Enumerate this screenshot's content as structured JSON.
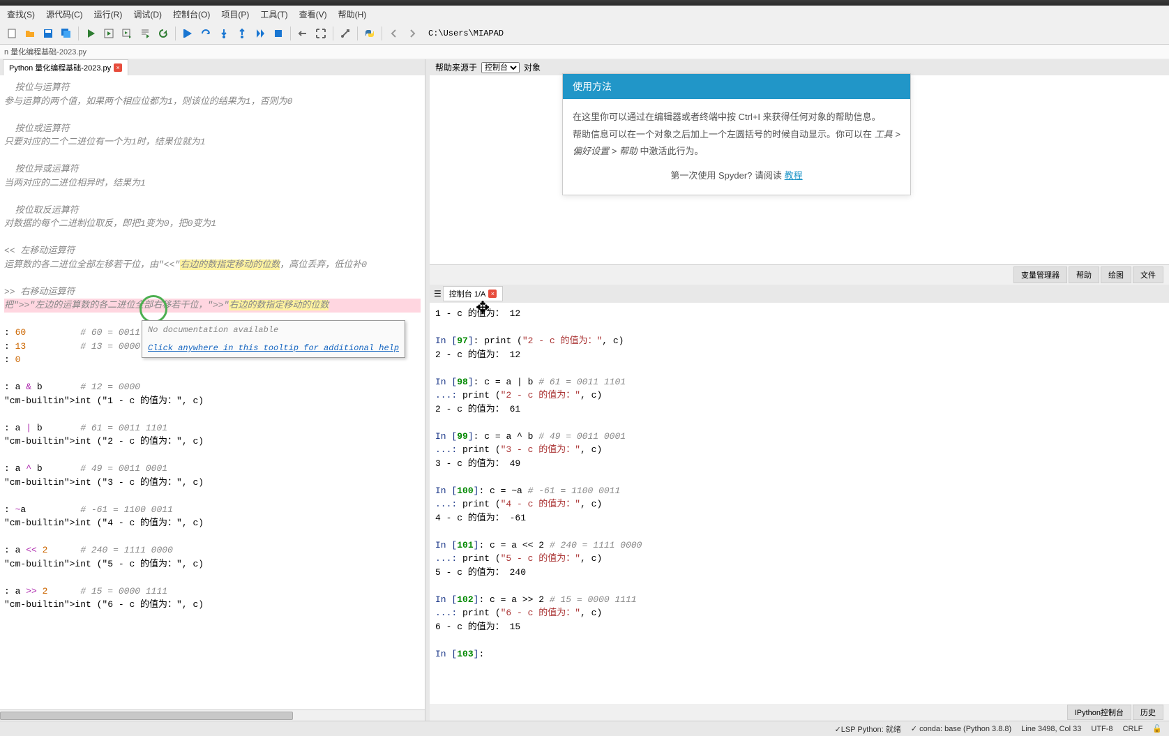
{
  "menubar": [
    "查找(S)",
    "源代码(C)",
    "运行(R)",
    "调试(D)",
    "控制台(O)",
    "项目(P)",
    "工具(T)",
    "查看(V)",
    "帮助(H)"
  ],
  "path": "C:\\Users\\MIAPAD",
  "breadcrumb": "n 量化编程基础-2023.py",
  "tab_name": "Python 量化编程基础-2023.py",
  "code_lines": [
    {
      "t": "comment",
      "x": "  按位与运算符"
    },
    {
      "t": "comment",
      "x": "参与运算的两个值，如果两个相应位都为1，则该位的结果为1，否则为0"
    },
    {
      "t": "blank",
      "x": ""
    },
    {
      "t": "comment",
      "x": "  按位或运算符"
    },
    {
      "t": "comment",
      "x": "只要对应的二个二进位有一个为1时，结果位就为1"
    },
    {
      "t": "blank",
      "x": ""
    },
    {
      "t": "comment",
      "x": "  按位异或运算符"
    },
    {
      "t": "comment",
      "x": "当两对应的二进位相异时，结果为1"
    },
    {
      "t": "blank",
      "x": ""
    },
    {
      "t": "comment",
      "x": "  按位取反运算符"
    },
    {
      "t": "comment",
      "x": "对数据的每个二进制位取反，即把1变为0，把0变为1"
    },
    {
      "t": "blank",
      "x": ""
    },
    {
      "t": "hl1a",
      "x": "<< 左移动运算符"
    },
    {
      "t": "hl1b",
      "x": "运算数的各二进位全部左移若干位，由\"<<\"",
      "hl": "右边的数指定移动的位数",
      "after": "，高位丢弃，低位补0"
    },
    {
      "t": "blank",
      "x": ""
    },
    {
      "t": "hl2a",
      "x": ">> 右移动运算符"
    },
    {
      "t": "hl2b",
      "x": "把\">>\"左边的运算数的各二进位全部右移若干位，\">>\"",
      "hl": "右边的数指定移动的位数"
    },
    {
      "t": "blank",
      "x": ""
    },
    {
      "t": "code",
      "x": ": 60          # 60 = 0011 1100"
    },
    {
      "t": "code",
      "x": ": 13          # 13 = 0000 1101"
    },
    {
      "t": "code",
      "x": ": 0"
    },
    {
      "t": "blank",
      "x": ""
    },
    {
      "t": "code",
      "x": ": a & b       # 12 = 0000"
    },
    {
      "t": "print",
      "x": "int (\"1 - c 的值为：\", c)"
    },
    {
      "t": "blank",
      "x": ""
    },
    {
      "t": "code",
      "x": ": a | b       # 61 = 0011 1101"
    },
    {
      "t": "print",
      "x": "int (\"2 - c 的值为：\", c)"
    },
    {
      "t": "blank",
      "x": ""
    },
    {
      "t": "code",
      "x": ": a ^ b       # 49 = 0011 0001"
    },
    {
      "t": "print",
      "x": "int (\"3 - c 的值为：\", c)"
    },
    {
      "t": "blank",
      "x": ""
    },
    {
      "t": "code",
      "x": ": ~a          # -61 = 1100 0011"
    },
    {
      "t": "print",
      "x": "int (\"4 - c 的值为：\", c)"
    },
    {
      "t": "blank",
      "x": ""
    },
    {
      "t": "code",
      "x": ": a << 2      # 240 = 1111 0000"
    },
    {
      "t": "print",
      "x": "int (\"5 - c 的值为：\", c)"
    },
    {
      "t": "blank",
      "x": ""
    },
    {
      "t": "code",
      "x": ": a >> 2      # 15 = 0000 1111"
    },
    {
      "t": "print",
      "x": "int (\"6 - c 的值为：\", c)"
    }
  ],
  "tooltip": {
    "line1": "No documentation available",
    "line2": "Click anywhere in this tooltip for additional help"
  },
  "help": {
    "source_label": "帮助来源于",
    "source_dropdown": "控制台",
    "object_label": "对象",
    "title": "使用方法",
    "body1": "在这里你可以通过在编辑器或者终端中按 Ctrl+I 来获得任何对象的帮助信息。",
    "body2_a": "帮助信息可以在一个对象之后加上一个左圆括号的时候自动显示。你可以在 ",
    "body2_b": "工具 > 偏好设置 > 帮助",
    "body2_c": " 中激活此行为。",
    "body3_a": "第一次使用 Spyder? 请阅读 ",
    "body3_b": "教程"
  },
  "right_tabs": [
    "变量管理器",
    "帮助",
    "绘图",
    "文件"
  ],
  "console_tab": "控制台 1/A",
  "console_lines": [
    {
      "raw": "1 - c 的值为： 12"
    },
    {
      "blank": true
    },
    {
      "in": "97",
      "body": ": print (\"2 - c 的值为：\", c)"
    },
    {
      "raw": "2 - c 的值为： 12"
    },
    {
      "blank": true
    },
    {
      "in": "98",
      "body": ": c = a | b          ",
      "cm": "# 61 = 0011 1101"
    },
    {
      "cont": "print (\"2 - c 的值为：\", c)"
    },
    {
      "raw": "2 - c 的值为： 61"
    },
    {
      "blank": true
    },
    {
      "in": "99",
      "body": ": c = a ^ b          ",
      "cm": "# 49 = 0011 0001"
    },
    {
      "cont": "print (\"3 - c 的值为：\", c)"
    },
    {
      "raw": "3 - c 的值为： 49"
    },
    {
      "blank": true
    },
    {
      "in": "100",
      "body": ": c = ~a             ",
      "cm": "# -61 = 1100 0011"
    },
    {
      "cont": "print (\"4 - c 的值为：\", c)"
    },
    {
      "raw": "4 - c 的值为： -61"
    },
    {
      "blank": true
    },
    {
      "in": "101",
      "body": ": c = a << 2         ",
      "cm": "# 240 = 1111 0000"
    },
    {
      "cont": "print (\"5 - c 的值为：\", c)"
    },
    {
      "raw": "5 - c 的值为： 240"
    },
    {
      "blank": true
    },
    {
      "in": "102",
      "body": ": c = a >> 2         ",
      "cm": "# 15 = 0000 1111"
    },
    {
      "cont": "print (\"6 - c 的值为：\", c)"
    },
    {
      "raw": "6 - c 的值为： 15"
    },
    {
      "blank": true
    },
    {
      "in": "103",
      "body": ":"
    }
  ],
  "bottom_tabs": [
    "IPython控制台",
    "历史"
  ],
  "status": {
    "lsp": "✓LSP Python: 就绪",
    "conda": "✓ conda: base (Python 3.8.8)",
    "pos": "Line 3498, Col 33",
    "enc": "UTF-8",
    "eol": "CRLF"
  }
}
